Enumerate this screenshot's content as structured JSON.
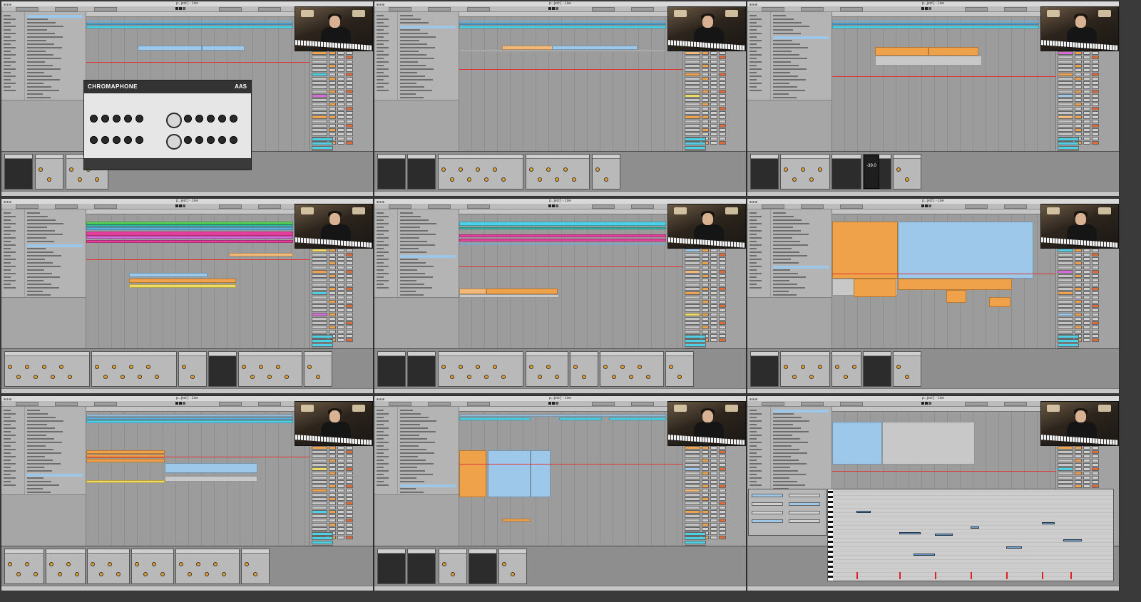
{
  "screen": {
    "description_free": true
  },
  "panes": [
    {
      "id": "p1",
      "title": "p...ject ] - Live",
      "plugin": {
        "title": "CHROMAPHONE",
        "logo": "AAS"
      }
    },
    {
      "id": "p2",
      "title": "p...ject ] - Live"
    },
    {
      "id": "p3",
      "title": "p...ject ] - Live",
      "gain_readout": "-39.0"
    },
    {
      "id": "p4",
      "title": "p...ject ] - Live"
    },
    {
      "id": "p5",
      "title": "p...ject ] - Live"
    },
    {
      "id": "p6",
      "title": "p...ject ] - Live"
    },
    {
      "id": "p7",
      "title": "p...ject ] - Live"
    },
    {
      "id": "p8",
      "title": "p...ject ] - Live"
    },
    {
      "id": "p9",
      "title": "p...ject ] - Live"
    }
  ],
  "colors": {
    "blue": "#5ab2e0",
    "cyan": "#4fd0e5",
    "teal": "#2fb8a8",
    "green": "#5bd15b",
    "pink": "#e53f9e",
    "magenta": "#d76ad9",
    "orange": "#f0a24a",
    "lightorange": "#f2b97a",
    "yellow": "#f1dc63",
    "lightblue": "#9ec8ea",
    "grayclip": "#c8c8c8"
  },
  "icons": {
    "window_controls": "traffic-light-dots",
    "transport_play": "play-icon",
    "transport_stop": "stop-icon",
    "transport_record": "record-icon"
  }
}
